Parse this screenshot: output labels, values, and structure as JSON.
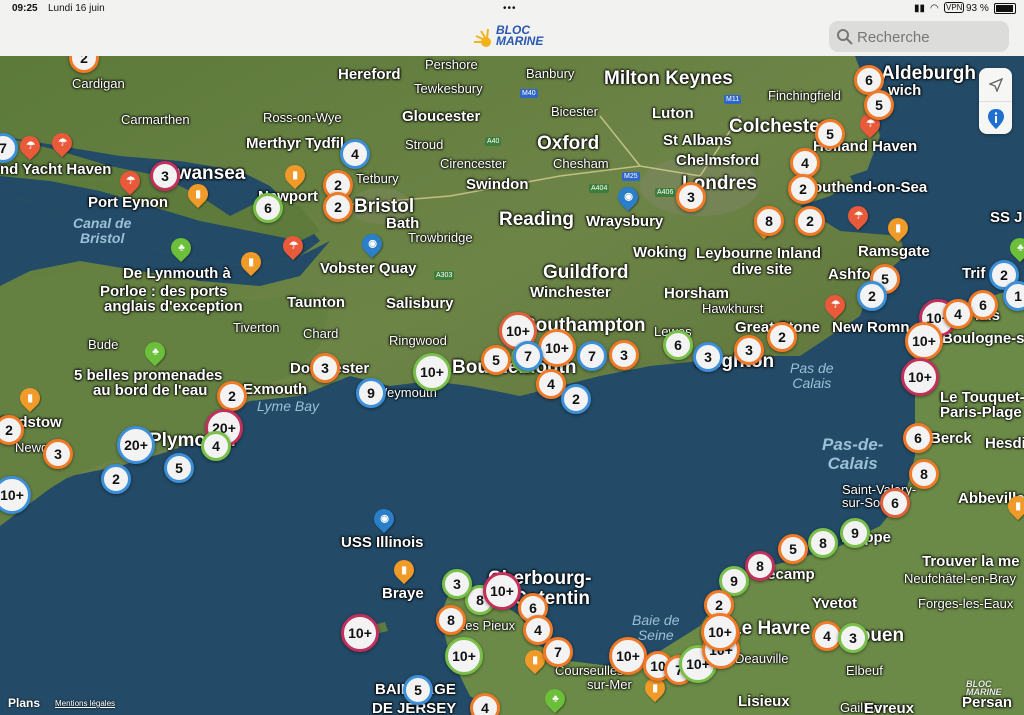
{
  "status": {
    "time": "09:25",
    "date": "Lundi 16 juin",
    "vpn": "VPN",
    "battery": "93 %"
  },
  "app": {
    "logo_line1": "BLOC",
    "logo_line2": "MARINE"
  },
  "search": {
    "placeholder": "Recherche"
  },
  "footer": {
    "plans": "Plans",
    "legal": "Mentions légales",
    "watermark": "BLOC\nMARINE"
  },
  "colors": {
    "land": "#5f7d3f",
    "sea": "#234a66",
    "cluster_orange": "#f07a28",
    "cluster_blue": "#3d8fd8",
    "cluster_green": "#79c04a"
  },
  "places": [
    {
      "t": "Aldeburgh",
      "c": "lg"
    },
    {
      "t": "wich",
      "c": "md"
    },
    {
      "t": "Hereford",
      "c": "md"
    },
    {
      "t": "Pershore",
      "c": "sm"
    },
    {
      "t": "Banbury",
      "c": "sm"
    },
    {
      "t": "Milton Keynes",
      "c": "lg"
    },
    {
      "t": "Cardigan",
      "c": "sm"
    },
    {
      "t": "Tewkesbury",
      "c": "sm"
    },
    {
      "t": "Finchingfield",
      "c": "sm"
    },
    {
      "t": "Carmarthen",
      "c": "sm"
    },
    {
      "t": "Ross-on-Wye",
      "c": "sm"
    },
    {
      "t": "Gloucester",
      "c": "md"
    },
    {
      "t": "Bicester",
      "c": "sm"
    },
    {
      "t": "Luton",
      "c": "md"
    },
    {
      "t": "Colchester",
      "c": "lg"
    },
    {
      "t": "Merthyr Tydfil",
      "c": "md"
    },
    {
      "t": "Stroud",
      "c": "sm"
    },
    {
      "t": "Oxford",
      "c": "lg"
    },
    {
      "t": "St Albans",
      "c": "md"
    },
    {
      "t": "Holland Haven",
      "c": "md"
    },
    {
      "t": "nd Yacht Haven",
      "c": "md"
    },
    {
      "t": "Swansea",
      "c": "lg"
    },
    {
      "t": "Tetbury",
      "c": "sm"
    },
    {
      "t": "Cirencester",
      "c": "sm"
    },
    {
      "t": "Chesham",
      "c": "sm"
    },
    {
      "t": "Chelmsford",
      "c": "md"
    },
    {
      "t": "Swindon",
      "c": "md"
    },
    {
      "t": "Londres",
      "c": "lg"
    },
    {
      "t": "outhend-on-Sea",
      "c": "md"
    },
    {
      "t": "Port Eynon",
      "c": "md"
    },
    {
      "t": "Newport",
      "c": "md"
    },
    {
      "t": "Bristol",
      "c": "lg"
    },
    {
      "t": "Bath",
      "c": "md"
    },
    {
      "t": "Reading",
      "c": "lg"
    },
    {
      "t": "Wraysbury",
      "c": "md"
    },
    {
      "t": "SS J",
      "c": "md"
    },
    {
      "t": "Trowbridge",
      "c": "sm"
    },
    {
      "t": "Woking",
      "c": "md"
    },
    {
      "t": "Leybourne Inland",
      "c": "md"
    },
    {
      "t": "dive site",
      "c": "md"
    },
    {
      "t": "Ramsgate",
      "c": "md"
    },
    {
      "t": "De Lynmouth à",
      "c": "md"
    },
    {
      "t": "Vobster Quay",
      "c": "md"
    },
    {
      "t": "Guildford",
      "c": "lg"
    },
    {
      "t": "Trif",
      "c": "md"
    },
    {
      "t": "Porloe : des ports",
      "c": "md"
    },
    {
      "t": "Ashfo",
      "c": "md"
    },
    {
      "t": "anglais d'exception",
      "c": "md"
    },
    {
      "t": "Taunton",
      "c": "md"
    },
    {
      "t": "Salisbury",
      "c": "md"
    },
    {
      "t": "Winchester",
      "c": "md"
    },
    {
      "t": "Horsham",
      "c": "md"
    },
    {
      "t": "Hawkhurst",
      "c": "sm"
    },
    {
      "t": "lais",
      "c": "md"
    },
    {
      "t": "Tiverton",
      "c": "sm"
    },
    {
      "t": "Chard",
      "c": "sm"
    },
    {
      "t": "Southampton",
      "c": "lg"
    },
    {
      "t": "Great Stone",
      "c": "md"
    },
    {
      "t": "New Romn",
      "c": "md"
    },
    {
      "t": "Bude",
      "c": "sm"
    },
    {
      "t": "Ringwood",
      "c": "sm"
    },
    {
      "t": "Lewes",
      "c": "sm"
    },
    {
      "t": "Boulogne-sur-",
      "c": "md"
    },
    {
      "t": "5 belles promenades",
      "c": "md"
    },
    {
      "t": "Dorchester",
      "c": "md"
    },
    {
      "t": "Bournemouth",
      "c": "lg"
    },
    {
      "t": "Brighton",
      "c": "lg"
    },
    {
      "t": "au bord de l'eau",
      "c": "md"
    },
    {
      "t": "Exmouth",
      "c": "md"
    },
    {
      "t": "Weymouth",
      "c": "sm"
    },
    {
      "t": "Le Touquet-",
      "c": "md"
    },
    {
      "t": "Paris-Plage",
      "c": "md"
    },
    {
      "t": "Padstow",
      "c": "md"
    },
    {
      "t": "Plymouth",
      "c": "lg"
    },
    {
      "t": "Berck",
      "c": "md"
    },
    {
      "t": "Hesdin",
      "c": "md"
    },
    {
      "t": "Newquay",
      "c": "sm"
    },
    {
      "t": "Saint-Valery-",
      "c": "sm"
    },
    {
      "t": "sur-Somme",
      "c": "sm"
    },
    {
      "t": "Abbeville",
      "c": "md"
    },
    {
      "t": "Dieppe",
      "c": "md"
    },
    {
      "t": "USS Illinois",
      "c": "md"
    },
    {
      "t": "Cherbourg-",
      "c": "lg"
    },
    {
      "t": "Cotentin",
      "c": "lg"
    },
    {
      "t": "Trouver la me",
      "c": "md"
    },
    {
      "t": "Fécamp",
      "c": "md"
    },
    {
      "t": "Neufchâtel-en-Bray",
      "c": "sm"
    },
    {
      "t": "Braye",
      "c": "md"
    },
    {
      "t": "Yvetot",
      "c": "md"
    },
    {
      "t": "Forges-les-Eaux",
      "c": "sm"
    },
    {
      "t": "Les Pieux",
      "c": "sm"
    },
    {
      "t": "Le Havre",
      "c": "lg"
    },
    {
      "t": "Rouen",
      "c": "lg"
    },
    {
      "t": "Deauville",
      "c": "sm"
    },
    {
      "t": "Elbeuf",
      "c": "sm"
    },
    {
      "t": "Courseulles-",
      "c": "sm"
    },
    {
      "t": "sur-Mer",
      "c": "sm"
    },
    {
      "t": "Lisieux",
      "c": "md"
    },
    {
      "t": "Gaillon",
      "c": "sm"
    },
    {
      "t": "Evreux",
      "c": "md"
    },
    {
      "t": "BAILLIAGE",
      "c": "md"
    },
    {
      "t": "DE JERSEY",
      "c": "md"
    },
    {
      "t": "Persan",
      "c": "md"
    }
  ],
  "seas": [
    {
      "t": "Canal de\nBristol"
    },
    {
      "t": "Lyme Bay"
    },
    {
      "t": "Pas de\nCalais"
    },
    {
      "t": "Pas-de-\nCalais"
    },
    {
      "t": "Baie de\nSeine"
    }
  ],
  "roads": [
    "M40",
    "M11",
    "A40",
    "M25",
    "A404",
    "A406",
    "A303"
  ],
  "clusters": [
    {
      "n": "2",
      "c": "o"
    },
    {
      "n": "6",
      "c": "o"
    },
    {
      "n": "5",
      "c": "o"
    },
    {
      "n": "7",
      "c": "b"
    },
    {
      "n": "5",
      "c": "o"
    },
    {
      "n": "4",
      "c": "b"
    },
    {
      "n": "3",
      "c": "p"
    },
    {
      "n": "4",
      "c": "o"
    },
    {
      "n": "2",
      "c": "o"
    },
    {
      "n": "2",
      "c": "o"
    },
    {
      "n": "3",
      "c": "o"
    },
    {
      "n": "6",
      "c": "g"
    },
    {
      "n": "8",
      "c": "o"
    },
    {
      "n": "2",
      "c": "o"
    },
    {
      "n": "2",
      "c": "o"
    },
    {
      "n": "2",
      "c": "b"
    },
    {
      "n": "1",
      "c": "b"
    },
    {
      "n": "5",
      "c": "o"
    },
    {
      "n": "2",
      "c": "b"
    },
    {
      "n": "6",
      "c": "o"
    },
    {
      "n": "10+",
      "c": "p"
    },
    {
      "n": "4",
      "c": "o"
    },
    {
      "n": "10+",
      "c": "m"
    },
    {
      "n": "10+",
      "c": "o"
    },
    {
      "n": "10+",
      "c": "o"
    },
    {
      "n": "7",
      "c": "g"
    },
    {
      "n": "5",
      "c": "o"
    },
    {
      "n": "7",
      "c": "b"
    },
    {
      "n": "3",
      "c": "o"
    },
    {
      "n": "6",
      "c": "g"
    },
    {
      "n": "3",
      "c": "b"
    },
    {
      "n": "3",
      "c": "o"
    },
    {
      "n": "2",
      "c": "o"
    },
    {
      "n": "10+",
      "c": "g"
    },
    {
      "n": "6",
      "c": "o"
    },
    {
      "n": "3",
      "c": "o"
    },
    {
      "n": "10+",
      "c": "p"
    },
    {
      "n": "9",
      "c": "b"
    },
    {
      "n": "4",
      "c": "o"
    },
    {
      "n": "2",
      "c": "b"
    },
    {
      "n": "2",
      "c": "o"
    },
    {
      "n": "20+",
      "c": "b"
    },
    {
      "n": "2",
      "c": "o"
    },
    {
      "n": "20+",
      "c": "p"
    },
    {
      "n": "3",
      "c": "o"
    },
    {
      "n": "4",
      "c": "g"
    },
    {
      "n": "5",
      "c": "b"
    },
    {
      "n": "2",
      "c": "b"
    },
    {
      "n": "10+",
      "c": "b"
    },
    {
      "n": "8",
      "c": "o"
    },
    {
      "n": "6",
      "c": "m"
    },
    {
      "n": "9",
      "c": "g"
    },
    {
      "n": "8",
      "c": "g"
    },
    {
      "n": "5",
      "c": "o"
    },
    {
      "n": "8",
      "c": "p"
    },
    {
      "n": "9",
      "c": "g"
    },
    {
      "n": "2",
      "c": "o"
    },
    {
      "n": "10+",
      "c": "o"
    },
    {
      "n": "4",
      "c": "o"
    },
    {
      "n": "3",
      "c": "g"
    },
    {
      "n": "8",
      "c": "g"
    },
    {
      "n": "10+",
      "c": "p"
    },
    {
      "n": "3",
      "c": "g"
    },
    {
      "n": "6",
      "c": "o"
    },
    {
      "n": "8",
      "c": "o"
    },
    {
      "n": "4",
      "c": "o"
    },
    {
      "n": "10+",
      "c": "p"
    },
    {
      "n": "10+",
      "c": "g"
    },
    {
      "n": "7",
      "c": "o"
    },
    {
      "n": "10+",
      "c": "o"
    },
    {
      "n": "10",
      "c": "o"
    },
    {
      "n": "7",
      "c": "o"
    },
    {
      "n": "10+",
      "c": "g"
    },
    {
      "n": "10+",
      "c": "o"
    },
    {
      "n": "10+",
      "c": "o"
    },
    {
      "n": "5",
      "c": "b"
    },
    {
      "n": "4",
      "c": "o"
    },
    {
      "n": "7",
      "c": "b"
    }
  ],
  "pins": [
    {
      "k": "beach",
      "col": "#e85a3a"
    },
    {
      "k": "beach",
      "col": "#e85a3a"
    },
    {
      "k": "beach",
      "col": "#e85a3a"
    },
    {
      "k": "bar",
      "col": "#f09a2a"
    },
    {
      "k": "bar",
      "col": "#f09a2a"
    },
    {
      "k": "dive",
      "col": "#2a7fc8"
    },
    {
      "k": "dive",
      "col": "#2a7fc8"
    },
    {
      "k": "beach",
      "col": "#e85a3a"
    },
    {
      "k": "park",
      "col": "#6cbf3a"
    },
    {
      "k": "bar",
      "col": "#f09a2a"
    },
    {
      "k": "beach",
      "col": "#e85a3a"
    },
    {
      "k": "bar",
      "col": "#f09a2a"
    },
    {
      "k": "park",
      "col": "#6cbf3a"
    },
    {
      "k": "beach",
      "col": "#e85a3a"
    },
    {
      "k": "bar",
      "col": "#f09a2a"
    },
    {
      "k": "beach",
      "col": "#e85a3a"
    },
    {
      "k": "bar",
      "col": "#f09a2a"
    },
    {
      "k": "dive",
      "col": "#2a7fc8"
    },
    {
      "k": "bar",
      "col": "#f09a2a"
    },
    {
      "k": "bar",
      "col": "#f09a2a"
    },
    {
      "k": "park",
      "col": "#6cbf3a"
    },
    {
      "k": "park",
      "col": "#6cbf3a"
    },
    {
      "k": "bar",
      "col": "#f09a2a"
    },
    {
      "k": "bar",
      "col": "#f09a2a"
    }
  ]
}
